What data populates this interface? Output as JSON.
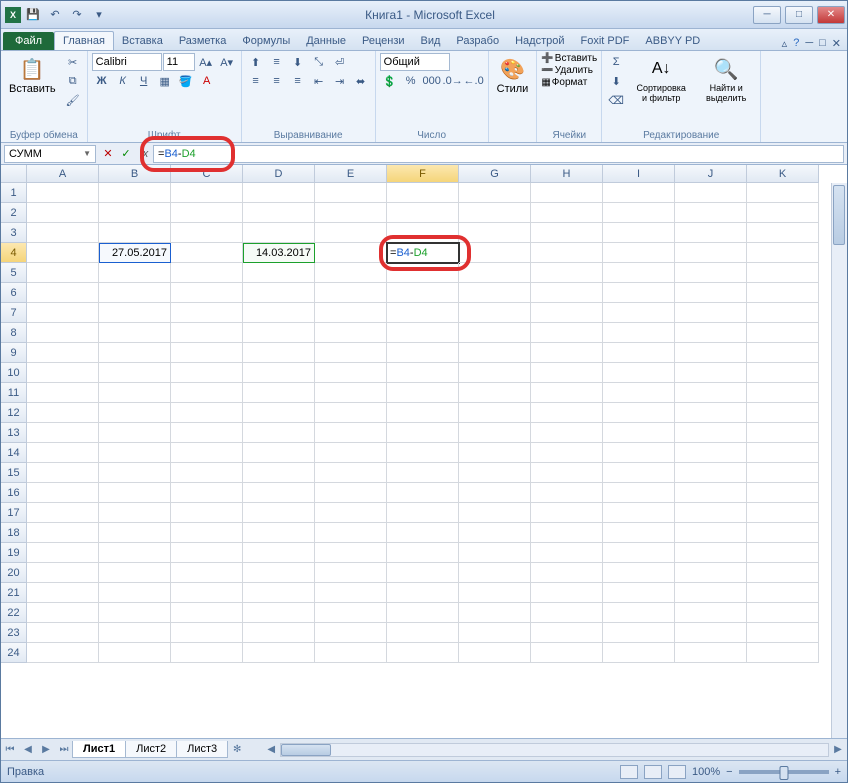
{
  "title": "Книга1 - Microsoft Excel",
  "tabs": {
    "file": "Файл",
    "list": [
      "Главная",
      "Вставка",
      "Разметка",
      "Формулы",
      "Данные",
      "Рецензи",
      "Вид",
      "Разрабо",
      "Надстрой",
      "Foxit PDF",
      "ABBYY PD"
    ],
    "active": "Главная"
  },
  "ribbon": {
    "clipboard": {
      "paste": "Вставить",
      "label": "Буфер обмена"
    },
    "font": {
      "name": "Calibri",
      "size": "11",
      "label": "Шрифт"
    },
    "align": {
      "label": "Выравнивание"
    },
    "number": {
      "format": "Общий",
      "label": "Число"
    },
    "styles": {
      "btn": "Стили"
    },
    "cells": {
      "insert": "Вставить",
      "delete": "Удалить",
      "format": "Формат",
      "label": "Ячейки"
    },
    "editing": {
      "sort": "Сортировка и фильтр",
      "find": "Найти и выделить",
      "label": "Редактирование"
    }
  },
  "nameBox": "СУММ",
  "formula": "=B4-D4",
  "formulaParts": {
    "eq": "=",
    "ref1": "B4",
    "op": "-",
    "ref2": "D4"
  },
  "columns": [
    "A",
    "B",
    "C",
    "D",
    "E",
    "F",
    "G",
    "H",
    "I",
    "J",
    "K"
  ],
  "activeCol": "F",
  "activeRow": 4,
  "cells": {
    "B4": "27.05.2017",
    "D4": "14.03.2017",
    "F4": "=B4-D4"
  },
  "sheets": [
    "Лист1",
    "Лист2",
    "Лист3"
  ],
  "activeSheet": "Лист1",
  "status": "Правка",
  "zoom": "100%"
}
